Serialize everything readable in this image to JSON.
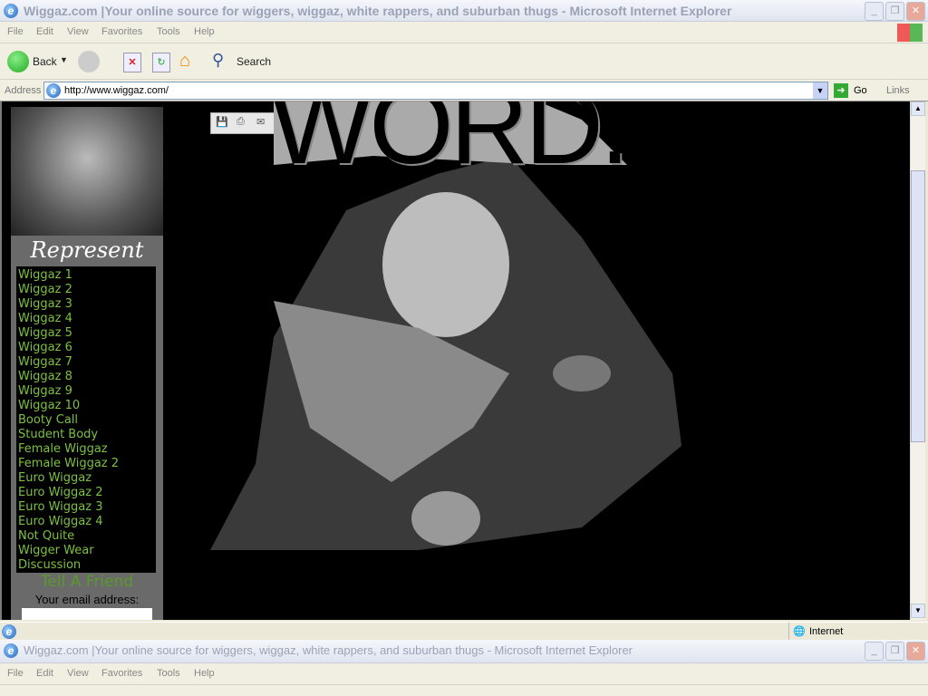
{
  "window": {
    "title": "Wiggaz.com |Your online source for wiggers, wiggaz, white rappers, and suburban thugs - Microsoft Internet Explorer"
  },
  "menu": [
    "File",
    "Edit",
    "View",
    "Favorites",
    "Tools",
    "Help"
  ],
  "toolbar": {
    "back": "Back",
    "search": "Search",
    "go": "Go",
    "links": "Links",
    "address_label": "Address"
  },
  "address": {
    "url": "http://www.wiggaz.com/"
  },
  "overlay": {
    "word": "WORD."
  },
  "sidebar": {
    "header": "Represent",
    "items": [
      "Wiggaz 1",
      "Wiggaz 2",
      "Wiggaz 3",
      "Wiggaz 4",
      "Wiggaz 5",
      "Wiggaz 6",
      "Wiggaz 7",
      "Wiggaz 8",
      "Wiggaz 9",
      "Wiggaz 10",
      "Booty Call",
      "Student Body",
      "Female Wiggaz",
      "Female Wiggaz 2",
      "Euro Wiggaz",
      "Euro Wiggaz 2",
      "Euro Wiggaz 3",
      "Euro Wiggaz 4",
      "Not Quite",
      "Wigger Wear",
      "Discussion"
    ],
    "tell_friend": "Tell A Friend",
    "email_label": "Your email address:"
  },
  "status": {
    "zone": "Internet"
  },
  "colors": {
    "link": "#7cc040",
    "tell_friend": "#5a9a2a",
    "page_bg": "#000000"
  }
}
